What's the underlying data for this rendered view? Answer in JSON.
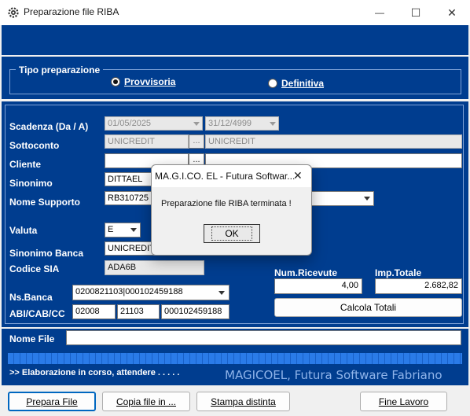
{
  "window": {
    "title": "Preparazione file RIBA",
    "app_icon": "gear-icon",
    "minimize_glyph": "—",
    "maximize_glyph": "☐",
    "close_glyph": "✕"
  },
  "tipo": {
    "legend": "Tipo preparazione",
    "option1": "Provvisoria",
    "option2": "Definitiva",
    "selected": "Provvisoria"
  },
  "form": {
    "scadenza_label": "Scadenza (Da / A)",
    "scadenza_da": "01/05/2025",
    "scadenza_a": "31/12/4999",
    "sottoconto_label": "Sottoconto",
    "sottoconto_code": "UNICREDIT",
    "sottoconto_desc": "UNICREDIT",
    "cliente_label": "Cliente",
    "cliente_code": "",
    "cliente_desc": "",
    "sinonimo_label": "Sinonimo",
    "sinonimo_value": "DITTAEL",
    "nome_supporto_label": "Nome Supporto",
    "nome_supporto_value": "RB310725",
    "valuta_label": "Valuta",
    "valuta_value": "E",
    "sinonimo_banca_label": "Sinonimo Banca",
    "sinonimo_banca_value": "UNICREDIT",
    "codice_sia_label": "Codice SIA",
    "codice_sia_value": "ADA6B",
    "nsbanca_label": "Ns.Banca",
    "nsbanca_value": "0200821103|000102459188",
    "abi_label": "ABI/CAB/CC",
    "abi": "02008",
    "cab": "21103",
    "cc": "000102459188",
    "dots": "..."
  },
  "totals": {
    "num_ricevute_label": "Num.Ricevute",
    "num_ricevute_value": "4,00",
    "imp_totale_label": "Imp.Totale",
    "imp_totale_value": "2.682,82",
    "calcola_button": "Calcola Totali"
  },
  "file": {
    "nome_file_label": "Nome File",
    "nome_file_value": "",
    "progress_fraction": 1.0,
    "status_text": ">> Elaborazione in corso, attendere . . . . .",
    "brand_text": "MAGICOEL, Futura Software Fabriano"
  },
  "buttons": {
    "prepara": "Prepara File",
    "copia": "Copia file in ...",
    "stampa": "Stampa distinta",
    "fine": "Fine Lavoro"
  },
  "dialog": {
    "title": "MA.G.I.CO. EL - Futura Softwar...",
    "message": "Preparazione file RIBA terminata !",
    "ok": "OK",
    "close_glyph": "✕"
  },
  "colors": {
    "panel_blue": "#003d8f",
    "progress_blue": "#1f6fdc",
    "brand_text": "#8fb4ea"
  }
}
